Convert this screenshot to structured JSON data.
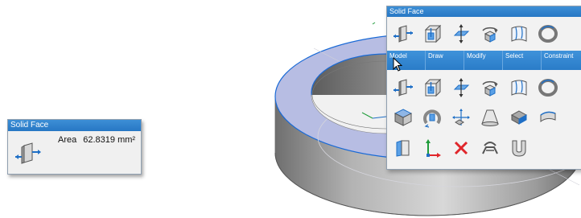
{
  "tooltip": {
    "title": "Solid Face",
    "area_label": "Area",
    "area_value": "62.8319 mm²",
    "icon": "solid-face-icon"
  },
  "panel": {
    "title": "Solid Face",
    "tabs": [
      "Model",
      "Draw",
      "Modify",
      "Select",
      "Constraint"
    ],
    "row1_icons": [
      "solid-face-icon",
      "box-face-icon",
      "move-plane-icon",
      "rotate-face-icon",
      "surface-icon",
      "revolve-icon"
    ],
    "row2_icons": [
      "solid-face-icon",
      "box-face-icon",
      "move-plane-icon",
      "rotate-face-icon",
      "surface-icon",
      "revolve-icon"
    ],
    "row3_icons": [
      "extrude-solid-icon",
      "revolve-solid-icon",
      "move-icon",
      "loft-icon",
      "chamfer-icon",
      "fillet-icon"
    ],
    "row4_icons": [
      "offset-face-icon",
      "coordinate-system-icon",
      "delete-icon",
      "pattern-icon",
      "shell-icon"
    ]
  },
  "colors": {
    "accent": "#2a7cc8",
    "selected_face": "#b7bde3",
    "edge_highlight": "#1a6ad6",
    "delete_red": "#e0262b"
  }
}
